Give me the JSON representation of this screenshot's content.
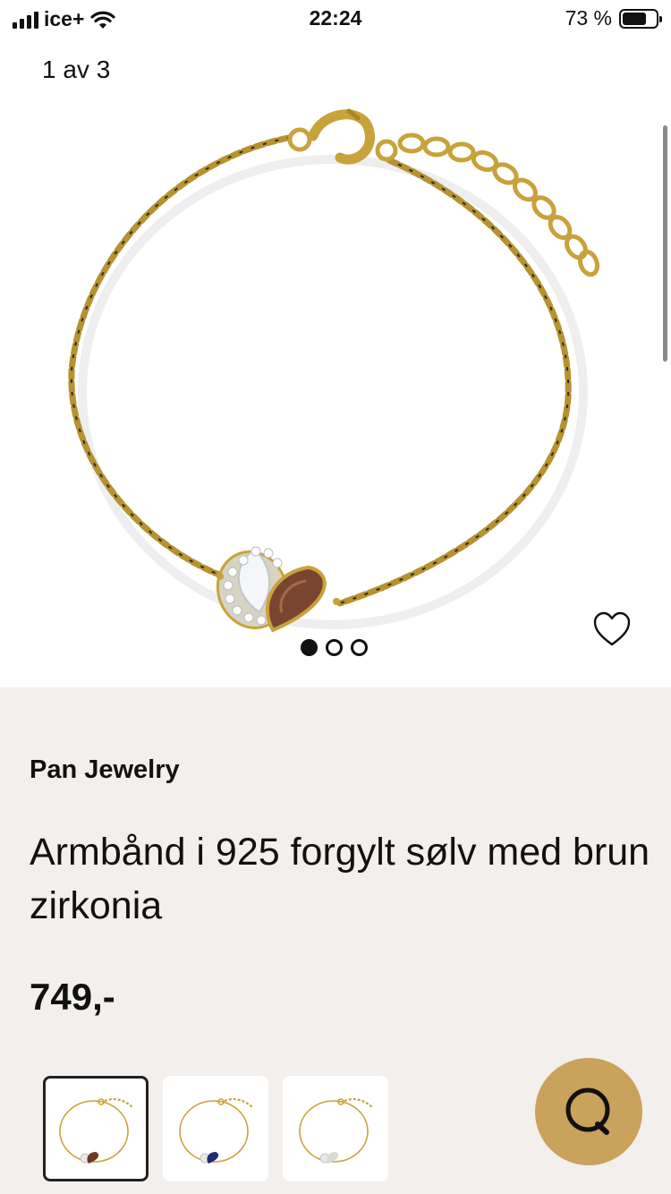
{
  "status": {
    "carrier": "ice+",
    "time": "22:24",
    "battery_percent": "73 %",
    "battery_level": 0.73
  },
  "gallery": {
    "counter": "1 av 3",
    "current_index": 1,
    "total": 3
  },
  "product": {
    "brand": "Pan Jewelry",
    "title": "Armbånd i 925 forgylt sølv med brun zirkonia",
    "price": "749,-"
  },
  "variants": [
    {
      "stone_color": "#6b3a24",
      "selected": true
    },
    {
      "stone_color": "#1f2a78",
      "selected": false
    },
    {
      "stone_color": "#d8d8d8",
      "selected": false
    }
  ],
  "colors": {
    "accent": "#c9a25b",
    "details_bg": "#f2efec",
    "gold": "#c8a23a"
  },
  "icons": {
    "favorite": "heart-outline-icon",
    "chat": "chat-bubble-icon"
  }
}
